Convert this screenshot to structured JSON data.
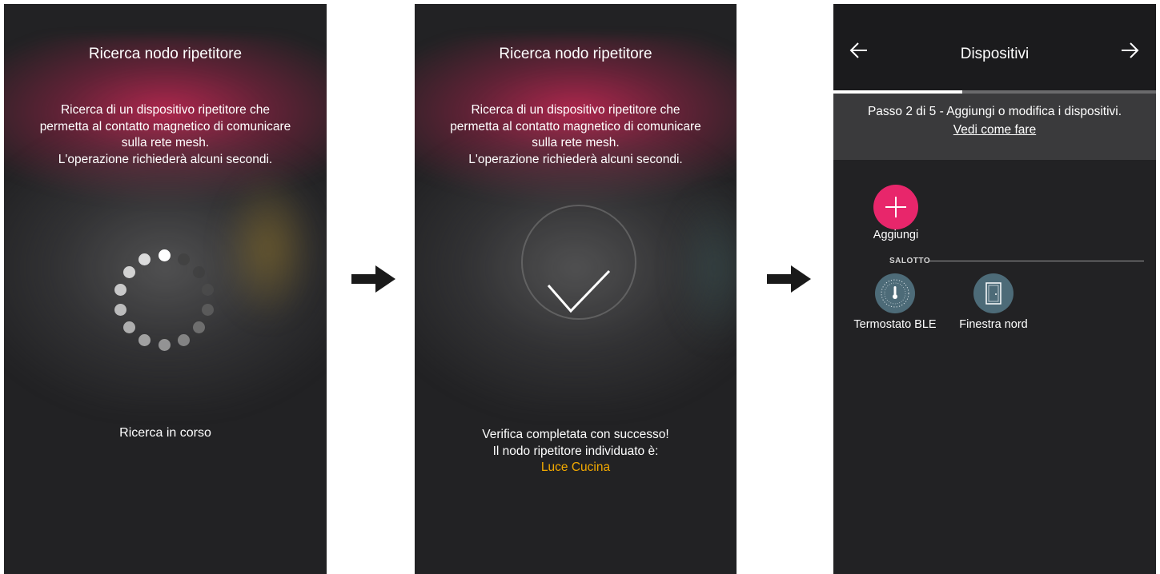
{
  "screen1": {
    "title": "Ricerca nodo ripetitore",
    "description": [
      "Ricerca di un dispositivo ripetitore che",
      "permetta al contatto magnetico di comunicare",
      "sulla rete mesh.",
      "L'operazione richiederà alcuni secondi."
    ],
    "status": "Ricerca in corso",
    "icon": "loading-spinner-icon"
  },
  "screen2": {
    "title": "Ricerca nodo ripetitore",
    "description": [
      "Ricerca di un dispositivo ripetitore che",
      "permetta al contatto magnetico di comunicare",
      "sulla rete mesh.",
      "L'operazione richiederà alcuni secondi."
    ],
    "result_line1": "Verifica completata con successo!",
    "result_line2": "Il nodo ripetitore individuato è:",
    "repeater_name": "Luce Cucina",
    "repeater_name_color": "#f2a900",
    "icon": "checkmark-icon"
  },
  "screen3": {
    "header": {
      "title": "Dispositivi",
      "back_icon": "arrow-left-icon",
      "next_icon": "arrow-right-icon",
      "progress": 0.4
    },
    "step": {
      "text": "Passo 2 di 5 - Aggiungi o modifica i dispositivi.",
      "link": "Vedi come fare"
    },
    "add": {
      "label": "Aggiungi",
      "icon": "plus-icon",
      "color": "#e8266b"
    },
    "section": {
      "label": "SALOTTO",
      "devices": [
        {
          "label": "Termostato BLE",
          "icon": "thermostat-icon"
        },
        {
          "label": "Finestra nord",
          "icon": "window-contact-icon"
        }
      ]
    }
  },
  "flow_arrow_icon": "arrow-right-icon",
  "colors": {
    "screen_background": "#222224",
    "accent_pink": "#e8266b",
    "accent_amber": "#f2a900",
    "device_icon_bg": "#4d6b78"
  }
}
